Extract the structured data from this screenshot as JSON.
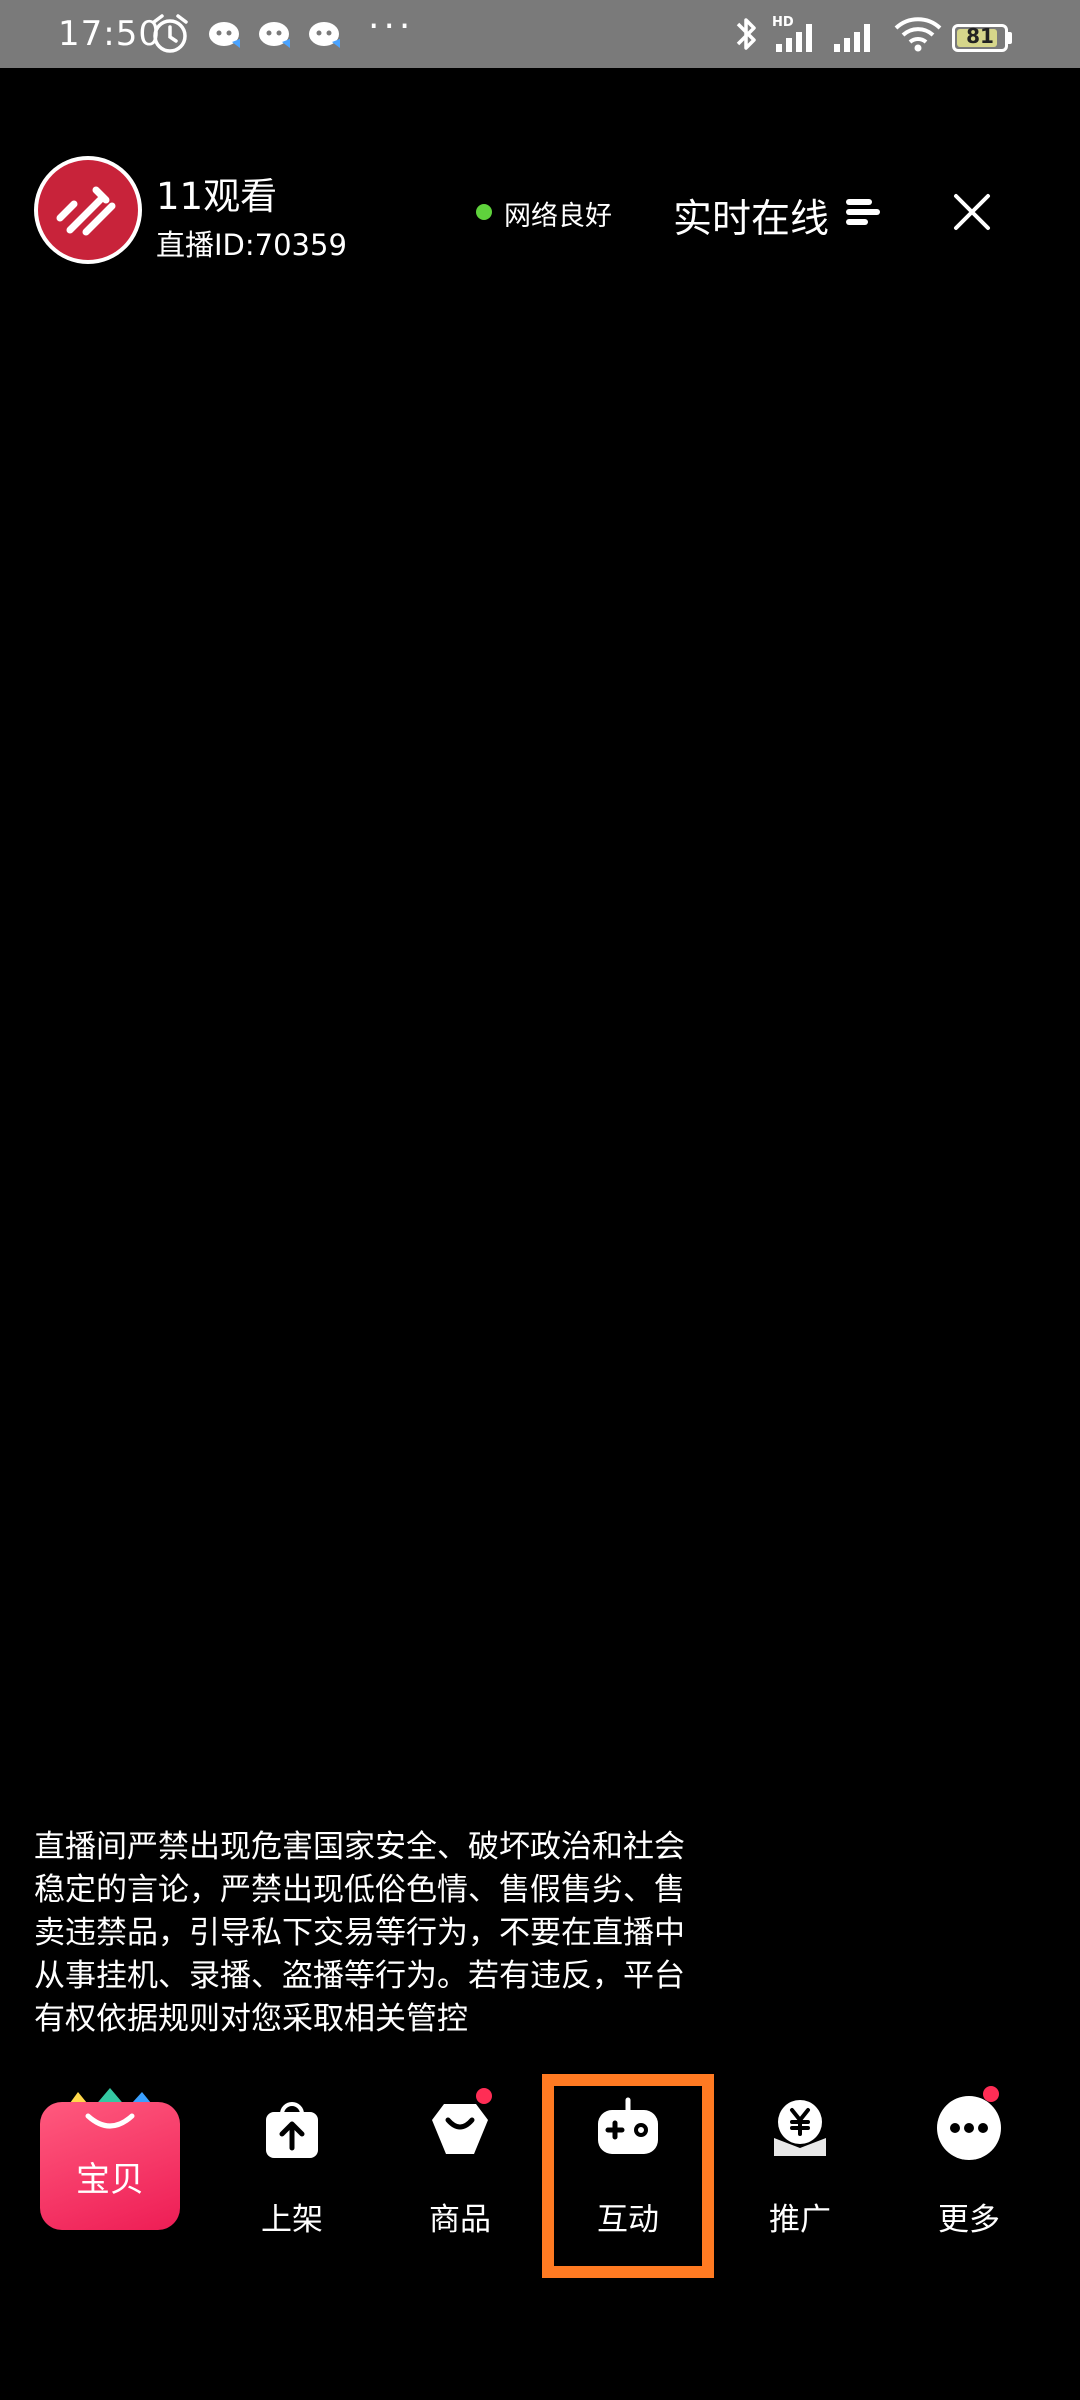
{
  "status_bar": {
    "time": "17:50",
    "battery": "81",
    "more_dots": "···"
  },
  "header": {
    "room_name": "11观看",
    "room_id": "直播ID:70359",
    "network_status": "网络良好",
    "realtime_online": "实时在线"
  },
  "notice": {
    "text": "直播间严禁出现危害国家安全、破坏政治和社会\n稳定的言论，严禁出现低俗色情、售假售劣、售\n卖违禁品，引导私下交易等行为，不要在直播中\n从事挂机、录播、盗播等行为。若有违反，平台\n有权依据规则对您采取相关管控"
  },
  "toolbar": {
    "baobei": "宝贝",
    "shangjia": "上架",
    "shangpin": "商品",
    "hudong": "互动",
    "tuiguang": "推广",
    "gengduo": "更多"
  },
  "colors": {
    "highlight": "#ff7a22",
    "network_ok": "#5fd23c",
    "badge": "#ff2d55"
  }
}
